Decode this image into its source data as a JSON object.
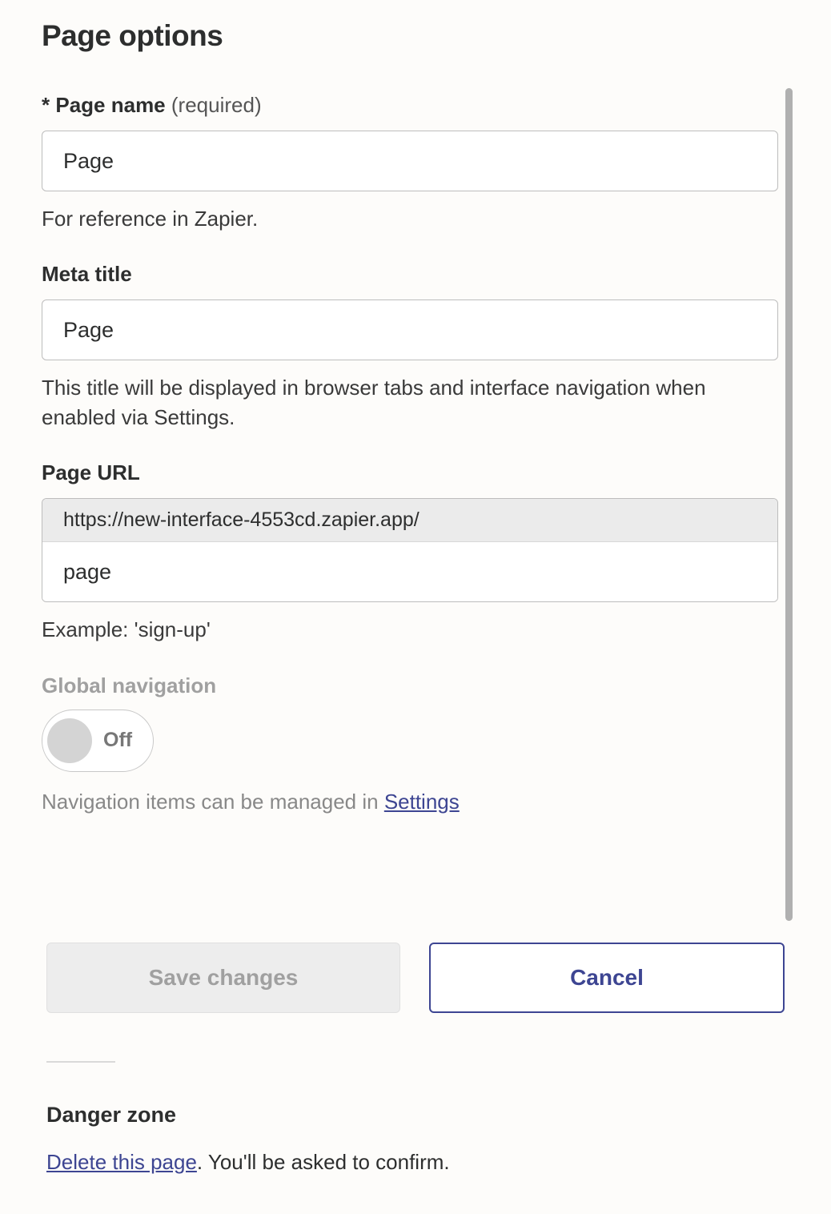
{
  "title": "Page options",
  "page_name": {
    "star": "*",
    "label": "Page name",
    "required_hint": "(required)",
    "value": "Page",
    "help": "For reference in Zapier."
  },
  "meta_title": {
    "label": "Meta title",
    "value": "Page",
    "help": "This title will be displayed in browser tabs and interface navigation when enabled via Settings."
  },
  "page_url": {
    "label": "Page URL",
    "prefix": "https://new-interface-4553cd.zapier.app/",
    "value": "page",
    "help": "Example: 'sign-up'"
  },
  "global_nav": {
    "label": "Global navigation",
    "state_label": "Off",
    "help_prefix": "Navigation items can be managed in ",
    "help_link": "Settings"
  },
  "buttons": {
    "save": "Save changes",
    "cancel": "Cancel"
  },
  "danger": {
    "heading": "Danger zone",
    "link": "Delete this page",
    "suffix": ". You'll be asked to confirm."
  }
}
